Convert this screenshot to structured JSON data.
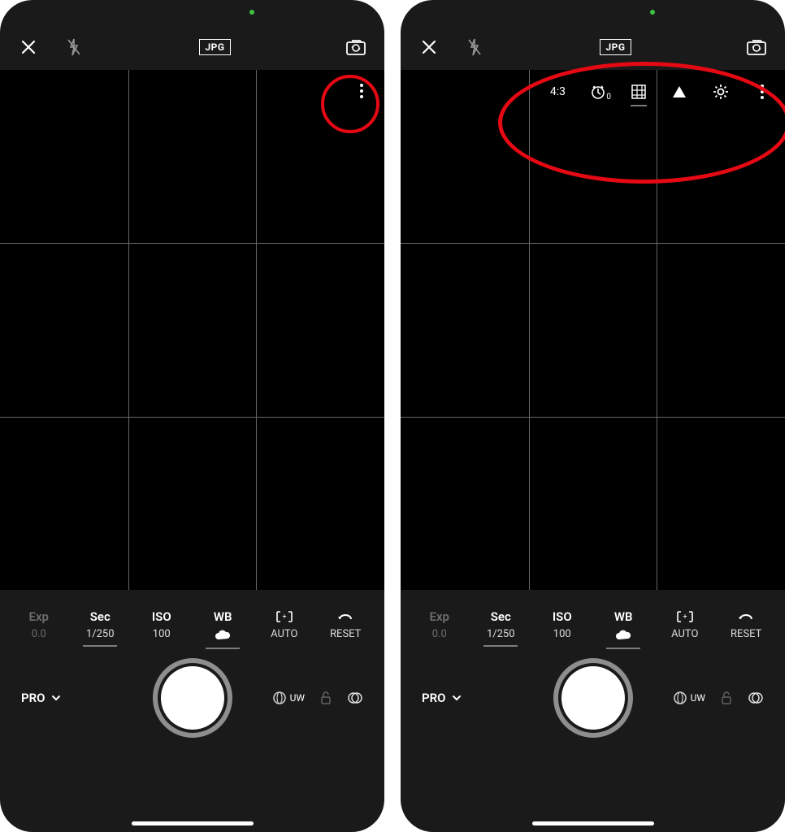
{
  "topbar": {
    "close_label": "Close",
    "flash_label": "Flash off",
    "format_badge": "JPG",
    "switch_camera_label": "Switch camera"
  },
  "vf_toolbar": {
    "aspect_ratio": "4:3",
    "timer_value": "0",
    "grid_label": "Grid",
    "histogram_label": "Histogram",
    "settings_label": "Settings",
    "more_label": "More"
  },
  "params": {
    "exp": {
      "label": "Exp",
      "value": "0.0"
    },
    "sec": {
      "label": "Sec",
      "value": "1/250"
    },
    "iso": {
      "label": "ISO",
      "value": "100"
    },
    "wb": {
      "label": "WB"
    },
    "af": {
      "value": "AUTO"
    },
    "reset": {
      "label": "RESET"
    }
  },
  "mode": {
    "label": "PRO"
  },
  "lens": {
    "label": "UW"
  },
  "annotation": {
    "color": "#e50914"
  }
}
